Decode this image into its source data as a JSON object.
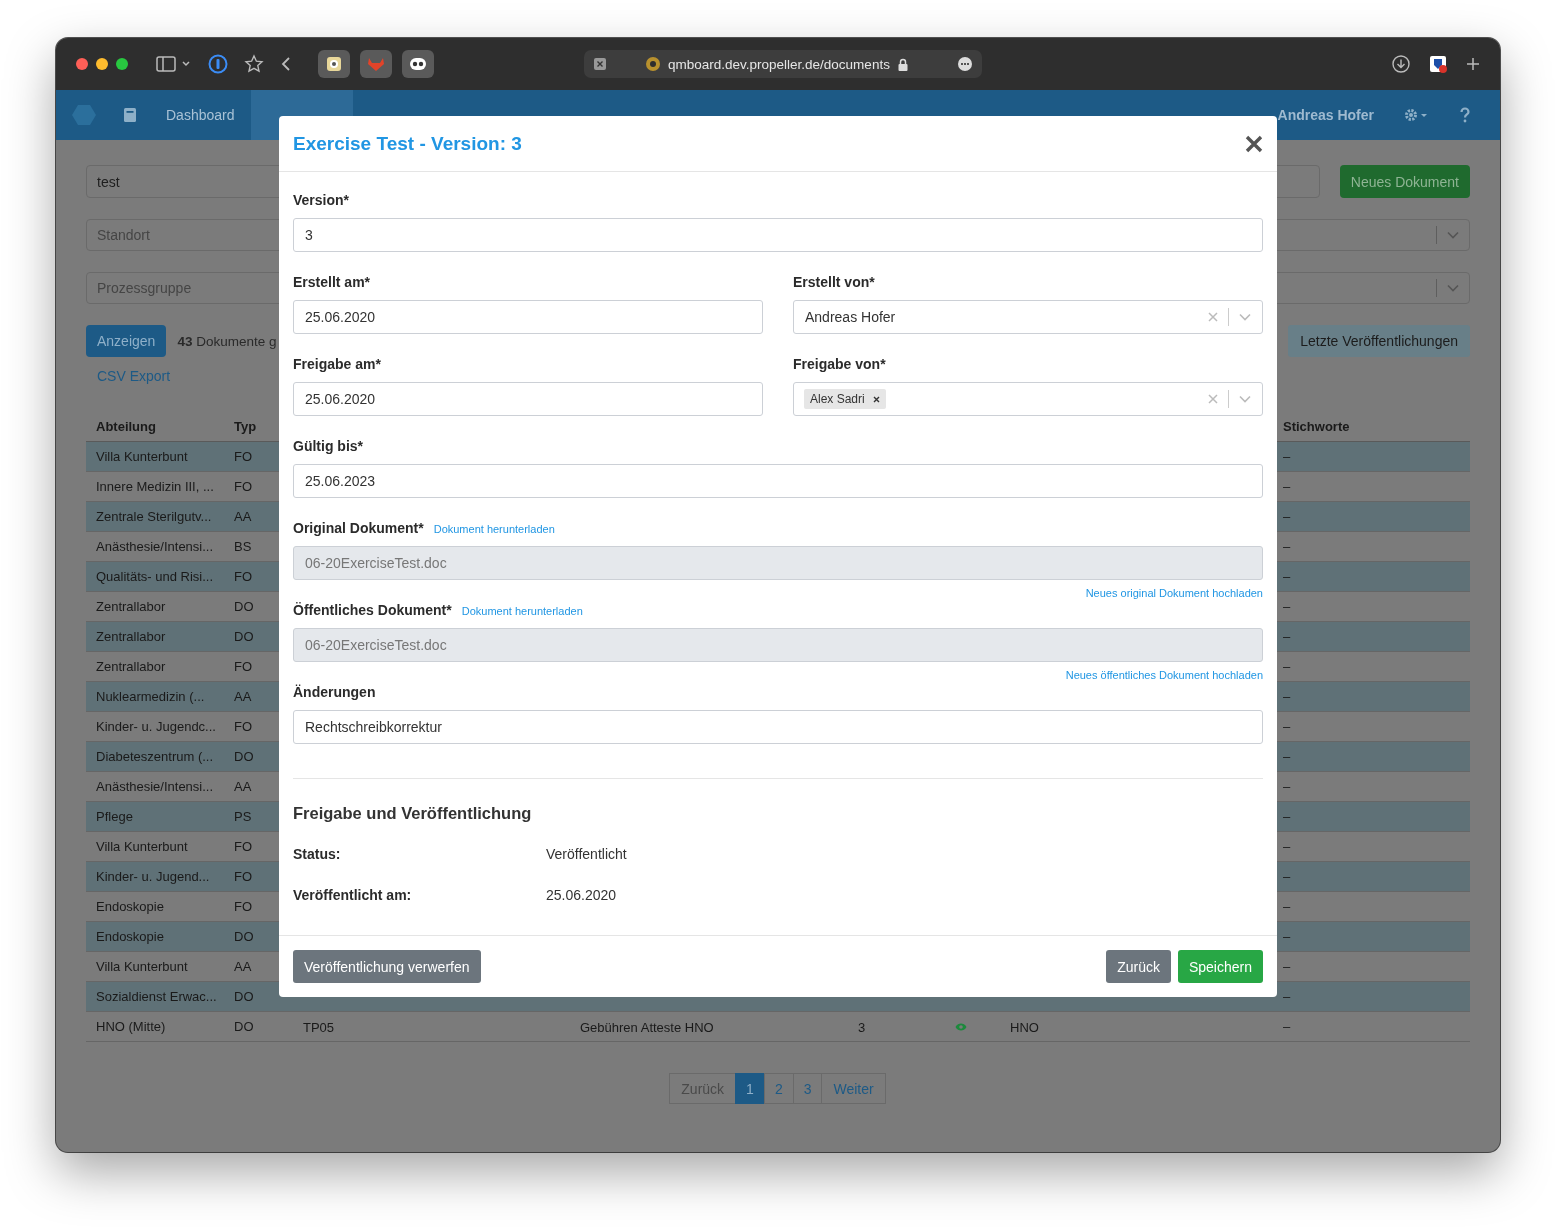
{
  "browser": {
    "url": "qmboard.dev.propeller.de/documents"
  },
  "nav": {
    "items": [
      {
        "label": "Dashboard",
        "selected": false
      }
    ],
    "user": "Andreas Hofer"
  },
  "filters": {
    "search": {
      "value": "test"
    },
    "new_button": "Neues Dokument",
    "selects": [
      {
        "placeholder": "Standort"
      },
      {
        "placeholder": "Prozessgruppe"
      }
    ],
    "show_button": "Anzeigen",
    "count": "**43** Dokumente g",
    "latest_button": "Letzte Veröffentlichungen",
    "export_link": "CSV Export"
  },
  "table": {
    "columns": [
      "Abteilung",
      "Typ",
      "Stichworte"
    ],
    "rows": [
      {
        "abteilung": "Villa Kunterbunt",
        "typ": "FO",
        "stichworte": "–"
      },
      {
        "abteilung": "Innere Medizin III, ...",
        "typ": "FO",
        "stichworte": "–"
      },
      {
        "abteilung": "Zentrale Sterilgutv...",
        "typ": "AA",
        "stichworte": "–"
      },
      {
        "abteilung": "Anästhesie/Intensi...",
        "typ": "BS",
        "stichworte": "–"
      },
      {
        "abteilung": "Qualitäts- und Risi...",
        "typ": "FO",
        "stichworte": "–"
      },
      {
        "abteilung": "Zentrallabor",
        "typ": "DO",
        "stichworte": "–"
      },
      {
        "abteilung": "Zentrallabor",
        "typ": "DO",
        "stichworte": "–"
      },
      {
        "abteilung": "Zentrallabor",
        "typ": "FO",
        "stichworte": "–"
      },
      {
        "abteilung": "Nuklearmedizin (...",
        "typ": "AA",
        "stichworte": "–"
      },
      {
        "abteilung": "Kinder- u. Jugendc...",
        "typ": "FO",
        "stichworte": "–"
      },
      {
        "abteilung": "Diabeteszentrum (...",
        "typ": "DO",
        "stichworte": "–"
      },
      {
        "abteilung": "Anästhesie/Intensi...",
        "typ": "AA",
        "stichworte": "–"
      },
      {
        "abteilung": "Pflege",
        "typ": "PS",
        "stichworte": "–"
      },
      {
        "abteilung": "Villa Kunterbunt",
        "typ": "FO",
        "stichworte": "–"
      },
      {
        "abteilung": "Kinder- u. Jugend...",
        "typ": "FO",
        "stichworte": "–"
      },
      {
        "abteilung": "Endoskopie",
        "typ": "FO",
        "stichworte": "–"
      },
      {
        "abteilung": "Endoskopie",
        "typ": "DO",
        "stichworte": "–"
      },
      {
        "abteilung": "Villa Kunterbunt",
        "typ": "AA",
        "stichworte": "–"
      },
      {
        "abteilung": "Sozialdienst Erwac...",
        "typ": "DO",
        "stichworte": "–"
      },
      {
        "abteilung": "HNO (Mitte)",
        "typ": "DO",
        "column_3": "TP05",
        "column_4": "Gebühren Atteste HNO",
        "column_5": "3",
        "published": true,
        "column_7": "HNO",
        "stichworte": "–"
      }
    ]
  },
  "pagination": [
    {
      "label": "Zurück",
      "kind": "prev",
      "disabled": true,
      "selected": false
    },
    {
      "label": "1",
      "kind": "page",
      "disabled": false,
      "selected": true
    },
    {
      "label": "2",
      "kind": "page",
      "disabled": false,
      "selected": false
    },
    {
      "label": "3",
      "kind": "page",
      "disabled": false,
      "selected": false
    },
    {
      "label": "Weiter",
      "kind": "next",
      "disabled": false,
      "selected": false
    }
  ],
  "modal": {
    "title": "Exercise Test - Version: 3",
    "rows": [
      [
        {
          "kind": "text",
          "label": "Version*",
          "value": "3"
        }
      ],
      [
        {
          "kind": "text",
          "label": "Erstellt am*",
          "value": "25.06.2020"
        },
        {
          "kind": "select",
          "label": "Erstellt von*",
          "value": "Andreas Hofer"
        }
      ],
      [
        {
          "kind": "text",
          "label": "Freigabe am*",
          "value": "25.06.2020"
        },
        {
          "kind": "tags",
          "label": "Freigabe von*",
          "tags": [
            "Alex Sadri"
          ]
        }
      ],
      [
        {
          "kind": "text",
          "label": "Gültig bis*",
          "value": "25.06.2023"
        }
      ],
      [
        {
          "kind": "file",
          "label": "Original Dokument*",
          "download": "Dokument herunterladen",
          "value": "06-20ExerciseTest.doc",
          "upload": "Neues original Dokument hochladen"
        }
      ],
      [
        {
          "kind": "file",
          "label": "Öffentliches Dokument*",
          "download": "Dokument herunterladen",
          "value": "06-20ExerciseTest.doc",
          "upload": "Neues öffentliches Dokument hochladen"
        }
      ],
      [
        {
          "kind": "text",
          "label": "Änderungen",
          "value": "Rechtschreibkorrektur"
        }
      ]
    ],
    "section_title": "Freigabe und Veröffentlichung",
    "info": [
      {
        "label": "Status:",
        "value": "Veröffentlicht"
      },
      {
        "label": "Veröffentlicht am:",
        "value": "25.06.2020"
      }
    ],
    "buttons": [
      {
        "label": "Veröffentlichung verwerfen",
        "kind": "secondary"
      },
      {
        "label": "Zurück",
        "kind": "secondary"
      },
      {
        "label": "Speichern",
        "kind": "primary"
      }
    ]
  }
}
